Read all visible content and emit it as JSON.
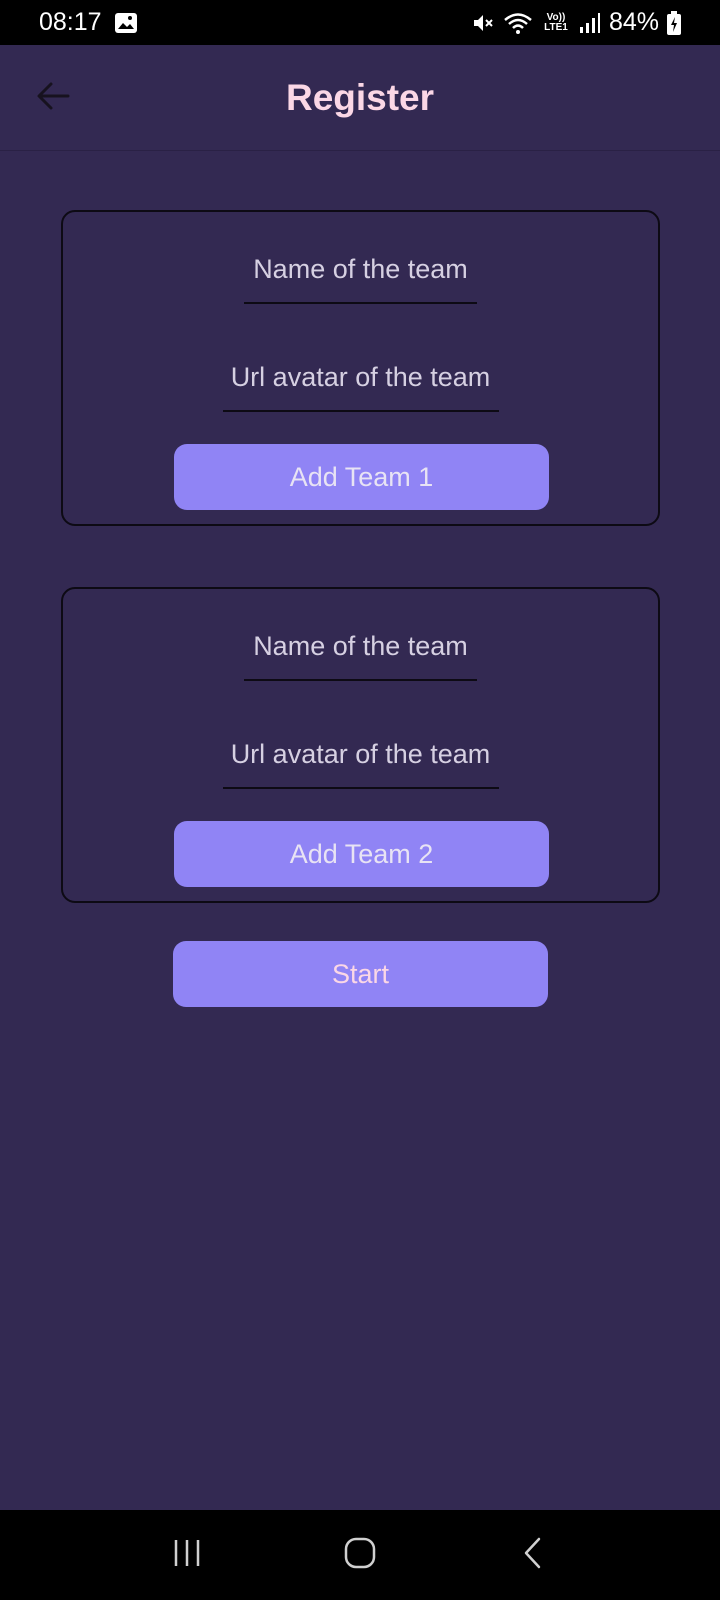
{
  "status_bar": {
    "time": "08:17",
    "battery": "84%",
    "icons": [
      "image-icon",
      "mute-icon",
      "wifi-icon",
      "volte-icon",
      "signal-icon",
      "battery-charging-icon"
    ],
    "volte_label": "Vo)) LTE1"
  },
  "app_bar": {
    "title": "Register",
    "back_icon": "arrow-left-icon"
  },
  "teams": [
    {
      "name_placeholder": "Name of the team",
      "url_placeholder": "Url avatar of the team",
      "button_label": "Add Team 1"
    },
    {
      "name_placeholder": "Name of the team",
      "url_placeholder": "Url avatar of the team",
      "button_label": "Add Team 2"
    }
  ],
  "start_label": "Start",
  "nav": {
    "recents_icon": "recents-icon",
    "home_icon": "home-icon",
    "back_icon": "back-chevron-icon"
  },
  "colors": {
    "background": "#332952",
    "accent_button": "#9084f5",
    "title": "#fbd7e6",
    "placeholder": "#d6d0e2"
  }
}
